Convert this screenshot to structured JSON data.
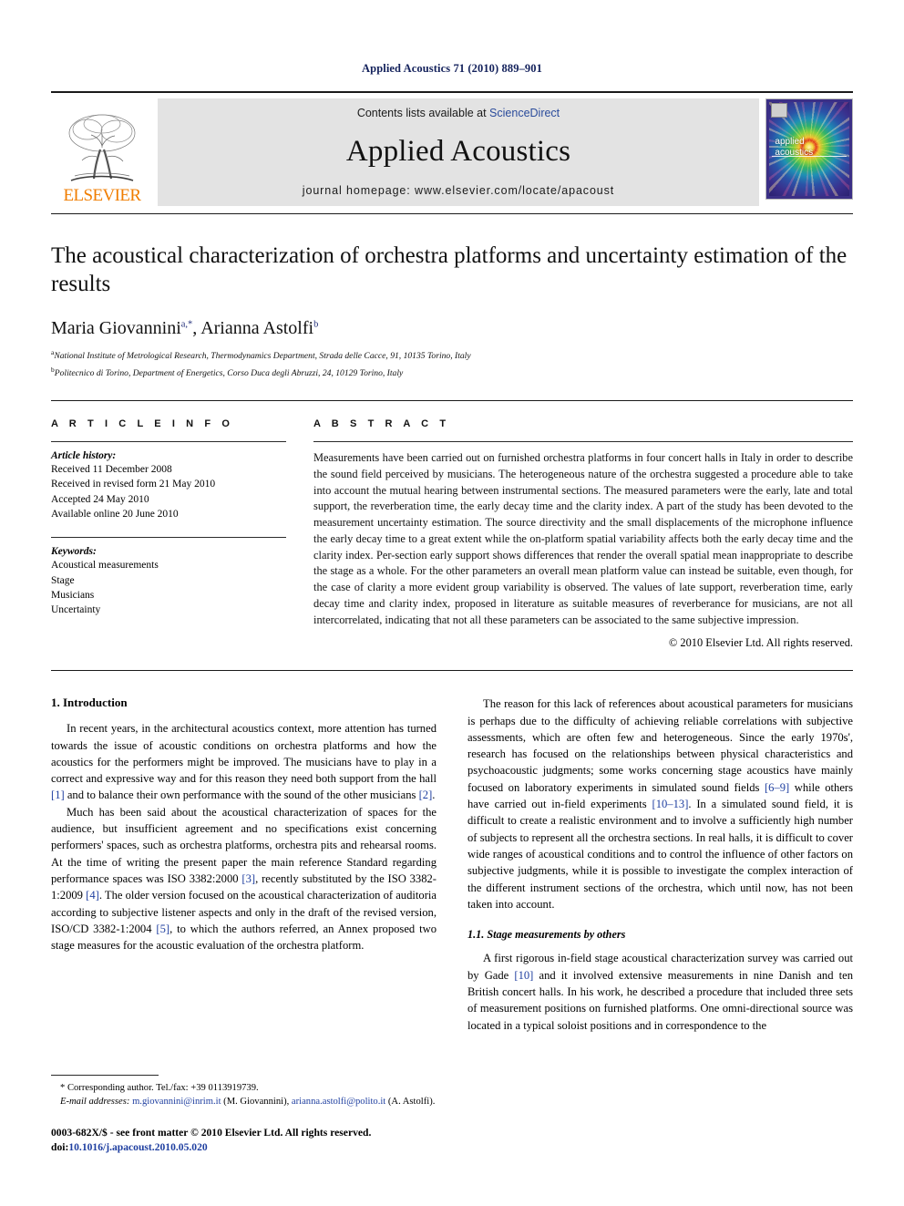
{
  "running_head": "Applied Acoustics 71 (2010) 889–901",
  "banner": {
    "publisher": "ELSEVIER",
    "contents_prefix": "Contents lists available at ",
    "contents_link": "ScienceDirect",
    "journal_title": "Applied Acoustics",
    "homepage": "journal homepage: www.elsevier.com/locate/apacoust",
    "cover_line1": "applied",
    "cover_line2": "acoustics"
  },
  "article": {
    "title": "The acoustical characterization of orchestra platforms and uncertainty estimation of the results",
    "authors": [
      {
        "name": "Maria Giovannini",
        "marks": "a,*"
      },
      {
        "name": "Arianna Astolfi",
        "marks": "b"
      }
    ],
    "authors_plain": "Maria Giovannini a,*, Arianna Astolfi b",
    "affiliations": [
      {
        "mark": "a",
        "text": "National Institute of Metrological Research, Thermodynamics Department, Strada delle Cacce, 91, 10135 Torino, Italy"
      },
      {
        "mark": "b",
        "text": "Politecnico di Torino, Department of Energetics, Corso Duca degli Abruzzi, 24, 10129 Torino, Italy"
      }
    ]
  },
  "article_info": {
    "heading": "A R T I C L E   I N F O",
    "history_label": "Article history:",
    "history": [
      "Received 11 December 2008",
      "Received in revised form 21 May 2010",
      "Accepted 24 May 2010",
      "Available online 20 June 2010"
    ],
    "keywords_label": "Keywords:",
    "keywords": [
      "Acoustical measurements",
      "Stage",
      "Musicians",
      "Uncertainty"
    ]
  },
  "abstract": {
    "heading": "A B S T R A C T",
    "text": "Measurements have been carried out on furnished orchestra platforms in four concert halls in Italy in order to describe the sound field perceived by musicians. The heterogeneous nature of the orchestra suggested a procedure able to take into account the mutual hearing between instrumental sections. The measured parameters were the early, late and total support, the reverberation time, the early decay time and the clarity index. A part of the study has been devoted to the measurement uncertainty estimation. The source directivity and the small displacements of the microphone influence the early decay time to a great extent while the on-platform spatial variability affects both the early decay time and the clarity index. Per-section early support shows differences that render the overall spatial mean inappropriate to describe the stage as a whole. For the other parameters an overall mean platform value can instead be suitable, even though, for the case of clarity a more evident group variability is observed. The values of late support, reverberation time, early decay time and clarity index, proposed in literature as suitable measures of reverberance for musicians, are not all intercorrelated, indicating that not all these parameters can be associated to the same subjective impression.",
    "copyright": "© 2010 Elsevier Ltd. All rights reserved."
  },
  "body": {
    "section1_heading": "1. Introduction",
    "left_paragraphs": [
      "In recent years, in the architectural acoustics context, more attention has turned towards the issue of acoustic conditions on orchestra platforms and how the acoustics for the performers might be improved. The musicians have to play in a correct and expressive way and for this reason they need both support from the hall [1] and to balance their own performance with the sound of the other musicians [2].",
      "Much has been said about the acoustical characterization of spaces for the audience, but insufficient agreement and no specifications exist concerning performers' spaces, such as orchestra platforms, orchestra pits and rehearsal rooms. At the time of writing the present paper the main reference Standard regarding performance spaces was ISO 3382:2000 [3], recently substituted by the ISO 3382-1:2009 [4]. The older version focused on the acoustical characterization of auditoria according to subjective listener aspects and only in the draft of the revised version, ISO/CD 3382-1:2004 [5], to which the authors referred, an Annex proposed two stage measures for the acoustic evaluation of the orchestra platform."
    ],
    "right_paragraphs": [
      "The reason for this lack of references about acoustical parameters for musicians is perhaps due to the difficulty of achieving reliable correlations with subjective assessments, which are often few and heterogeneous. Since the early 1970s', research has focused on the relationships between physical characteristics and psychoacoustic judgments; some works concerning stage acoustics have mainly focused on laboratory experiments in simulated sound fields [6–9] while others have carried out in-field experiments [10–13]. In a simulated sound field, it is difficult to create a realistic environment and to involve a sufficiently high number of subjects to represent all the orchestra sections. In real halls, it is difficult to cover wide ranges of acoustical conditions and to control the influence of other factors on subjective judgments, while it is possible to investigate the complex interaction of the different instrument sections of the orchestra, which until now, has not been taken into account."
    ],
    "subsection_heading": "1.1. Stage measurements by others",
    "right_paragraphs_2": [
      "A first rigorous in-field stage acoustical characterization survey was carried out by Gade [10] and it involved extensive measurements in nine Danish and ten British concert halls. In his work, he described a procedure that included three sets of measurement positions on furnished platforms. One omni-directional source was located in a typical soloist positions and in correspondence to the"
    ]
  },
  "footnote": {
    "corresponding": "* Corresponding author. Tel./fax: +39 0113919739.",
    "email_label": "E-mail addresses:",
    "email1": "m.giovannini@inrim.it",
    "email1_owner": "(M. Giovannini),",
    "email2": "arianna.astolfi@polito.it",
    "email2_owner": "(A. Astolfi).",
    "issn_line": "0003-682X/$ - see front matter © 2010 Elsevier Ltd. All rights reserved.",
    "doi_prefix": "doi:",
    "doi": "10.1016/j.apacoust.2010.05.020"
  }
}
